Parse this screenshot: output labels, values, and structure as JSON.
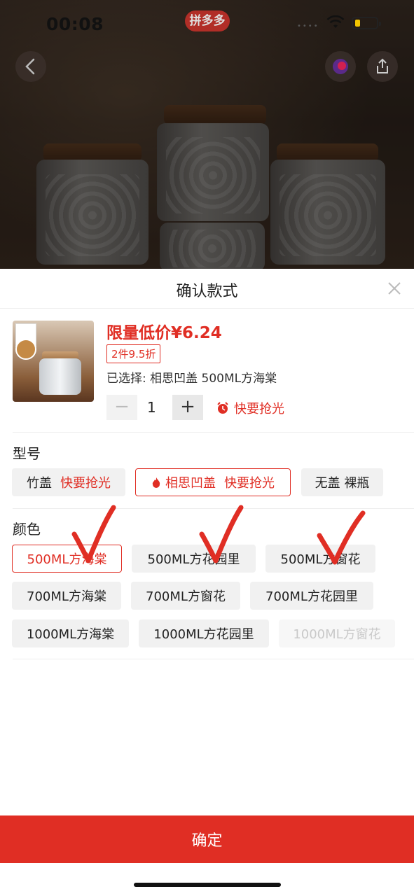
{
  "status_bar": {
    "time": "00:08",
    "brand": "拼多多"
  },
  "sheet": {
    "title": "确认款式",
    "price": "限量低价¥6.24",
    "discount": "2件9.5折",
    "selected": "已选择: 相思凹盖 500ML方海棠",
    "quantity": "1",
    "stepper_minus": "−",
    "stepper_plus": "+",
    "hurry_label": "快要抢光"
  },
  "model_section": {
    "title": "型号",
    "options": [
      {
        "label": "竹盖",
        "tag": "快要抢光",
        "state": "normal"
      },
      {
        "label": "相思凹盖",
        "tag": "快要抢光",
        "state": "selected"
      },
      {
        "label": "无盖 裸瓶",
        "tag": "",
        "state": "normal"
      }
    ]
  },
  "color_section": {
    "title": "颜色",
    "options": [
      {
        "label": "500ML方海棠",
        "state": "selected"
      },
      {
        "label": "500ML方花园里",
        "state": "normal"
      },
      {
        "label": "500ML方窗花",
        "state": "normal"
      },
      {
        "label": "700ML方海棠",
        "state": "normal"
      },
      {
        "label": "700ML方窗花",
        "state": "normal"
      },
      {
        "label": "700ML方花园里",
        "state": "normal"
      },
      {
        "label": "1000ML方海棠",
        "state": "normal"
      },
      {
        "label": "1000ML方花园里",
        "state": "normal"
      },
      {
        "label": "1000ML方窗花",
        "state": "disabled"
      }
    ]
  },
  "confirm_button": "确定",
  "colors": {
    "accent": "#e02e24",
    "chip_bg": "#f1f1f1",
    "disabled_text": "#c9c9c9"
  },
  "icons": [
    "back-icon",
    "shortcut-icon",
    "share-icon",
    "close-icon",
    "alarm-clock-icon",
    "flame-icon",
    "checkmark-annotation"
  ]
}
